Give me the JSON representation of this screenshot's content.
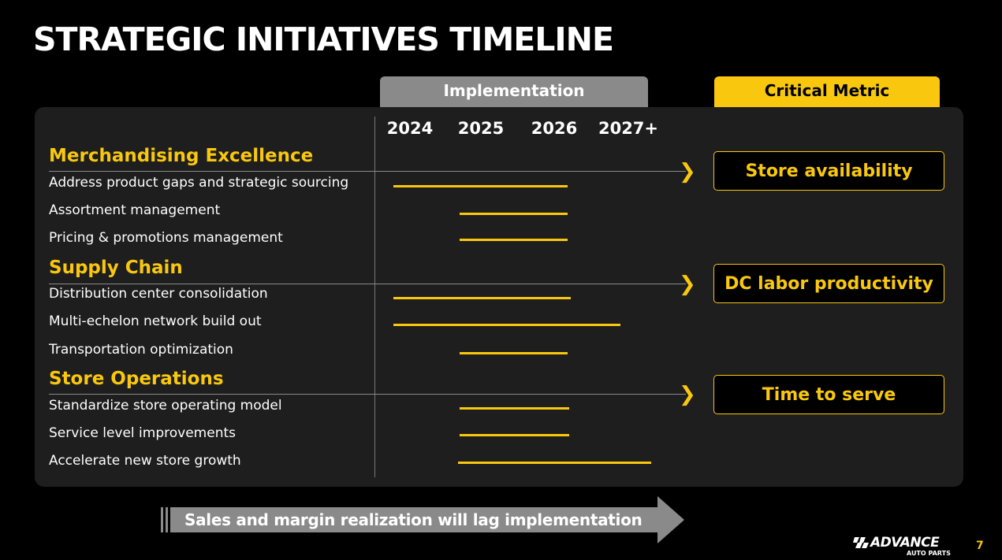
{
  "title": "STRATEGIC INITIATIVES TIMELINE",
  "header": {
    "implementation_label": "Implementation",
    "critical_metric_label": "Critical Metric"
  },
  "years": [
    "2024",
    "2025",
    "2026",
    "2027+"
  ],
  "sections": [
    {
      "name": "Merchandising Excellence",
      "metric": "Store availability",
      "items": [
        {
          "label": "Address product gaps and strategic sourcing",
          "start": "2024",
          "end": "2026"
        },
        {
          "label": "Assortment management",
          "start": "2025",
          "end": "2026"
        },
        {
          "label": "Pricing & promotions management",
          "start": "2025",
          "end": "2026"
        }
      ]
    },
    {
      "name": "Supply Chain",
      "metric": "DC labor productivity",
      "items": [
        {
          "label": "Distribution center consolidation",
          "start": "2024",
          "end": "2026"
        },
        {
          "label": "Multi-echelon network build out",
          "start": "2024",
          "end": "2027+"
        },
        {
          "label": "Transportation optimization",
          "start": "2025",
          "end": "2026"
        }
      ]
    },
    {
      "name": "Store Operations",
      "metric": "Time to serve",
      "items": [
        {
          "label": "Standardize store operating model",
          "start": "2025",
          "end": "2026"
        },
        {
          "label": "Service level improvements",
          "start": "2025",
          "end": "2026"
        },
        {
          "label": "Accelerate new store growth",
          "start": "2025",
          "end": "2027+"
        }
      ]
    }
  ],
  "footer_note": "Sales and margin realization will lag implementation",
  "logo": {
    "main": "ADVANCE",
    "sub": "AUTO PARTS"
  },
  "page_number": "7",
  "colors": {
    "accent": "#f9c80e",
    "panel": "#1e1e1e",
    "tab_gray": "#8a8a8a",
    "background": "#000000"
  }
}
